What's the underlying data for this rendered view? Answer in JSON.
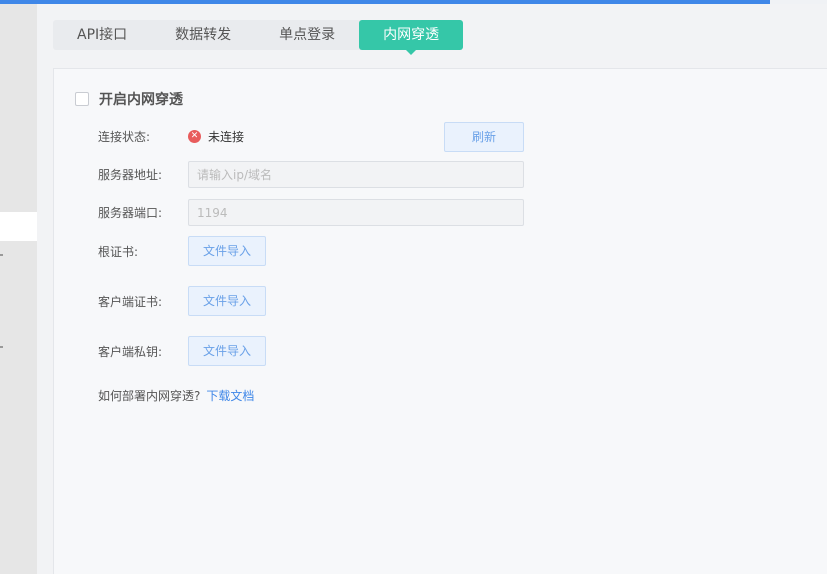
{
  "tabs": [
    {
      "label": "API接口"
    },
    {
      "label": "数据转发"
    },
    {
      "label": "单点登录"
    },
    {
      "label": "内网穿透"
    }
  ],
  "enable": {
    "label": "开启内网穿透",
    "checked": false
  },
  "connection": {
    "label": "连接状态:",
    "status_text": "未连接",
    "status_icon": "error-circle-icon",
    "refresh_label": "刷新"
  },
  "server_address": {
    "label": "服务器地址:",
    "placeholder": "请输入ip/域名",
    "value": ""
  },
  "server_port": {
    "label": "服务器端口:",
    "value": "1194"
  },
  "root_cert": {
    "label": "根证书:",
    "button_label": "文件导入"
  },
  "client_cert": {
    "label": "客户端证书:",
    "button_label": "文件导入"
  },
  "client_key": {
    "label": "客户端私钥:",
    "button_label": "文件导入"
  },
  "help": {
    "question": "如何部署内网穿透?",
    "link_text": "下载文档"
  },
  "colors": {
    "accent": "#35c7a8",
    "link": "#3f87e8",
    "error": "#e85c5c"
  }
}
